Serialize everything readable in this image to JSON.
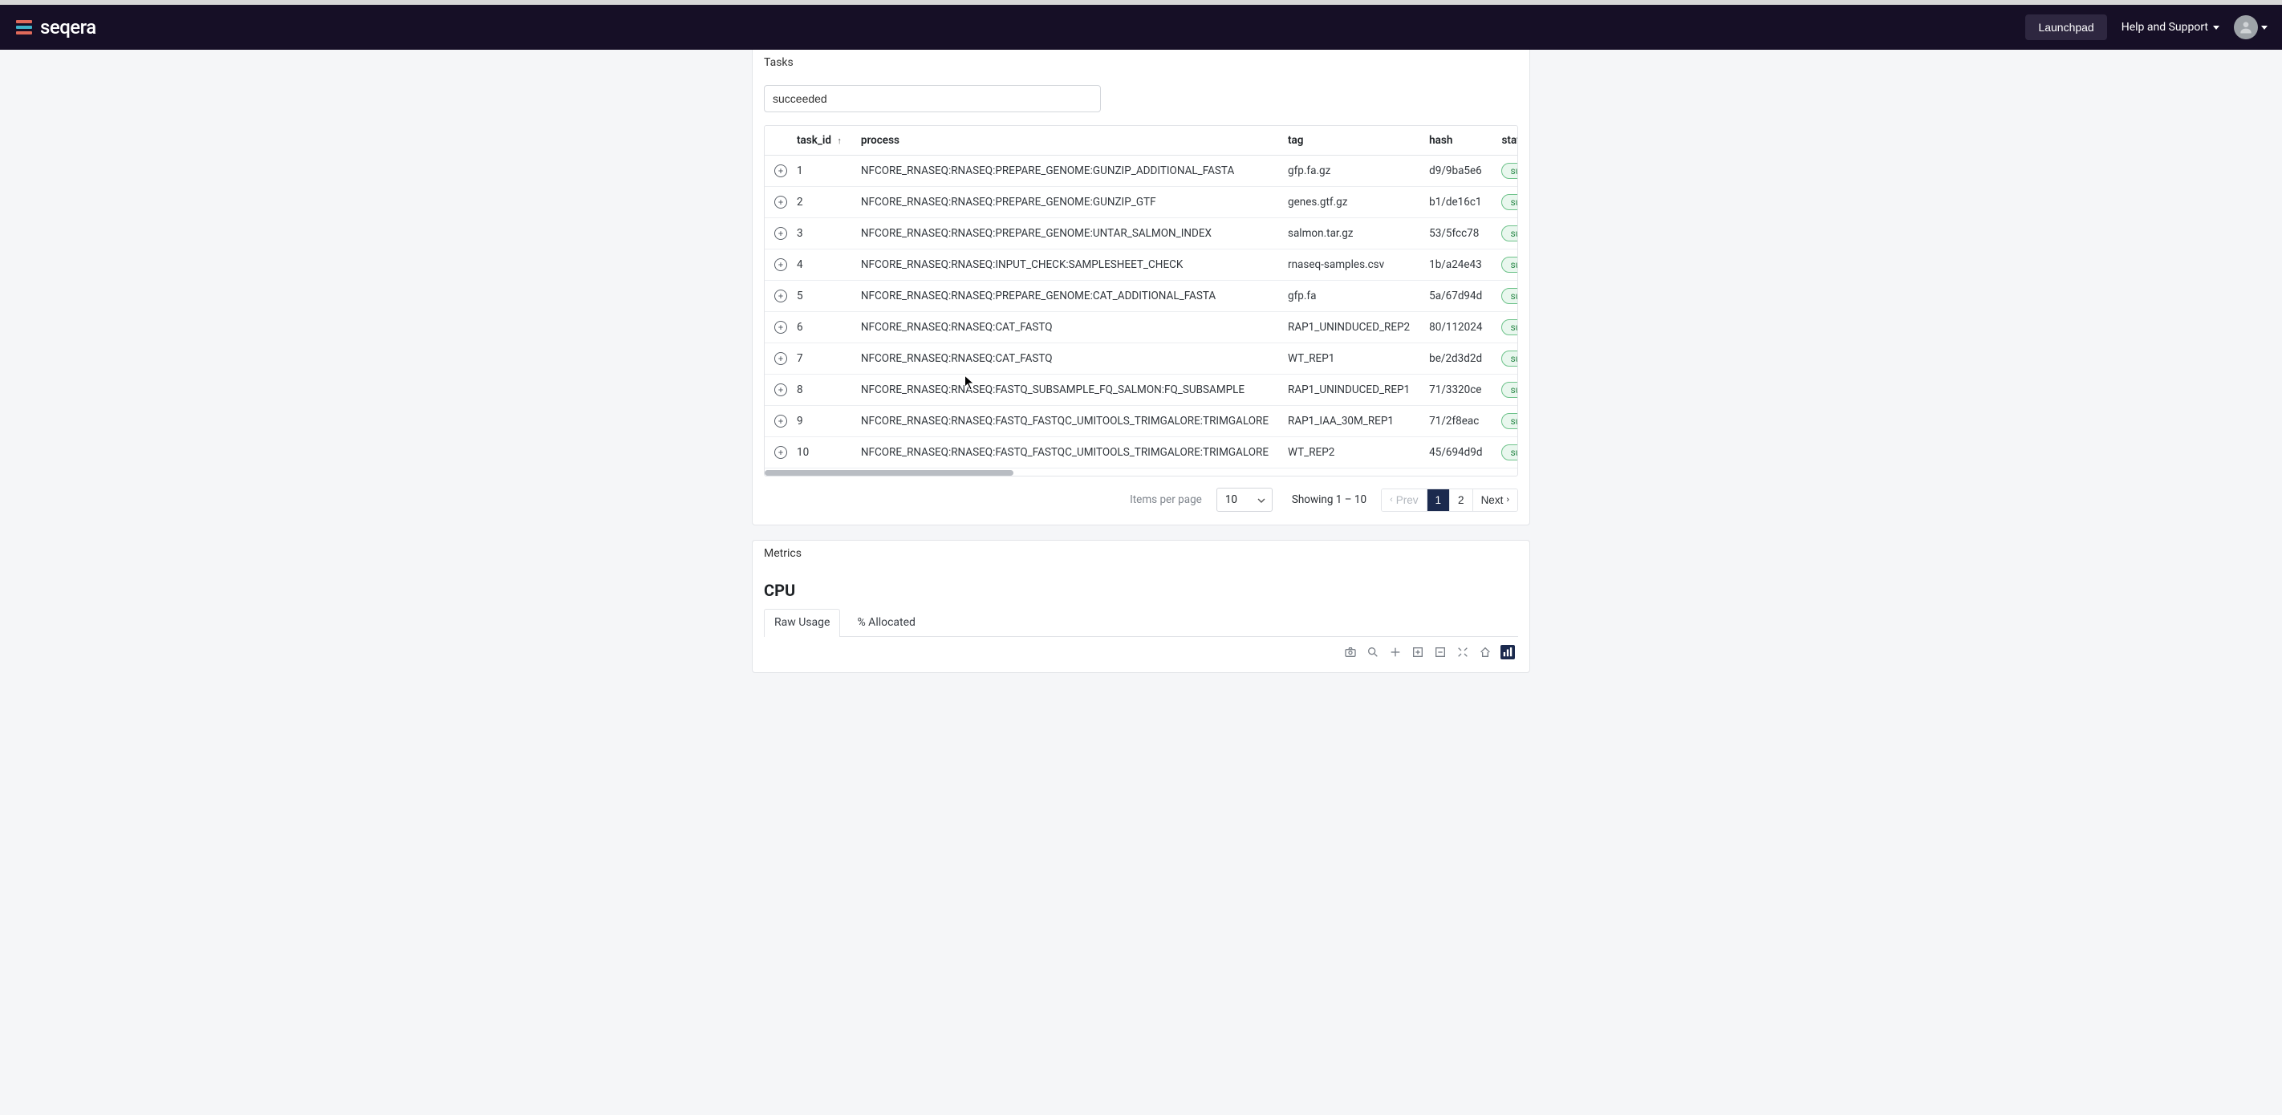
{
  "brand": "seqera",
  "nav": {
    "launchpad": "Launchpad",
    "help": "Help and Support"
  },
  "tasks": {
    "header": "Tasks",
    "search_value": "succeeded",
    "columns": {
      "task_id": "task_id",
      "process": "process",
      "tag": "tag",
      "hash": "hash",
      "status": "status"
    },
    "rows": [
      {
        "id": "1",
        "process": "NFCORE_RNASEQ:RNASEQ:PREPARE_GENOME:GUNZIP_ADDITIONAL_FASTA",
        "tag": "gfp.fa.gz",
        "hash": "d9/9ba5e6",
        "status": "succeeded"
      },
      {
        "id": "2",
        "process": "NFCORE_RNASEQ:RNASEQ:PREPARE_GENOME:GUNZIP_GTF",
        "tag": "genes.gtf.gz",
        "hash": "b1/de16c1",
        "status": "succeeded"
      },
      {
        "id": "3",
        "process": "NFCORE_RNASEQ:RNASEQ:PREPARE_GENOME:UNTAR_SALMON_INDEX",
        "tag": "salmon.tar.gz",
        "hash": "53/5fcc78",
        "status": "succeeded"
      },
      {
        "id": "4",
        "process": "NFCORE_RNASEQ:RNASEQ:INPUT_CHECK:SAMPLESHEET_CHECK",
        "tag": "rnaseq-samples.csv",
        "hash": "1b/a24e43",
        "status": "succeeded"
      },
      {
        "id": "5",
        "process": "NFCORE_RNASEQ:RNASEQ:PREPARE_GENOME:CAT_ADDITIONAL_FASTA",
        "tag": "gfp.fa",
        "hash": "5a/67d94d",
        "status": "succeeded"
      },
      {
        "id": "6",
        "process": "NFCORE_RNASEQ:RNASEQ:CAT_FASTQ",
        "tag": "RAP1_UNINDUCED_REP2",
        "hash": "80/112024",
        "status": "succeeded"
      },
      {
        "id": "7",
        "process": "NFCORE_RNASEQ:RNASEQ:CAT_FASTQ",
        "tag": "WT_REP1",
        "hash": "be/2d3d2d",
        "status": "succeeded"
      },
      {
        "id": "8",
        "process": "NFCORE_RNASEQ:RNASEQ:FASTQ_SUBSAMPLE_FQ_SALMON:FQ_SUBSAMPLE",
        "tag": "RAP1_UNINDUCED_REP1",
        "hash": "71/3320ce",
        "status": "succeeded"
      },
      {
        "id": "9",
        "process": "NFCORE_RNASEQ:RNASEQ:FASTQ_FASTQC_UMITOOLS_TRIMGALORE:TRIMGALORE",
        "tag": "RAP1_IAA_30M_REP1",
        "hash": "71/2f8eac",
        "status": "succeeded"
      },
      {
        "id": "10",
        "process": "NFCORE_RNASEQ:RNASEQ:FASTQ_FASTQC_UMITOOLS_TRIMGALORE:TRIMGALORE",
        "tag": "WT_REP2",
        "hash": "45/694d9d",
        "status": "succeeded"
      }
    ],
    "footer": {
      "ipp_label": "Items per page",
      "ipp_value": "10",
      "showing": "Showing 1 – 10",
      "prev": "Prev",
      "next": "Next",
      "pages": [
        "1",
        "2"
      ],
      "active_page": "1"
    }
  },
  "metrics": {
    "header": "Metrics",
    "cpu_title": "CPU",
    "tabs": {
      "raw": "Raw Usage",
      "pct": "% Allocated"
    }
  }
}
